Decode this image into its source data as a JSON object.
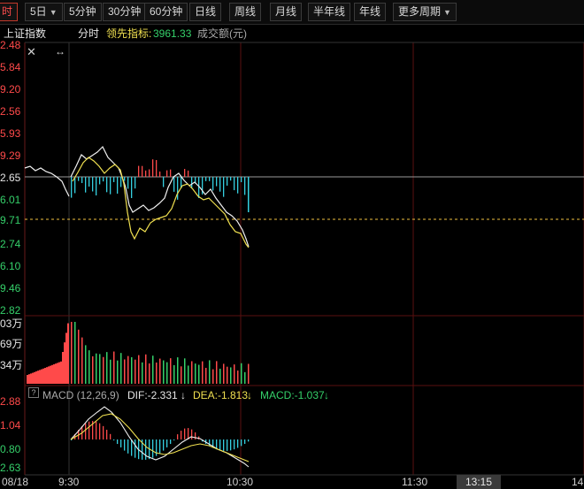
{
  "toolbar": {
    "items": [
      {
        "label": "时",
        "active": true
      },
      {
        "label": "5日",
        "dropdown": true
      },
      {
        "label": "5分钟"
      },
      {
        "label": "30分钟"
      },
      {
        "label": "60分钟"
      },
      {
        "label": "日线"
      },
      {
        "label": "周线"
      },
      {
        "label": "月线"
      },
      {
        "label": "半年线"
      },
      {
        "label": "年线"
      },
      {
        "label": "更多周期",
        "dropdown": true
      }
    ]
  },
  "infobar": {
    "name": "上证指数",
    "mode": "分时",
    "leading_label": "领先指标:",
    "leading_value": "3961.33",
    "volume_label": "成交额(元)"
  },
  "price_axis": [
    "2.48",
    "5.84",
    "9.20",
    "2.56",
    "5.93",
    "9.29",
    "2.65",
    "6.01",
    "9.71",
    "2.74",
    "6.10",
    "9.46",
    "2.82"
  ],
  "volume_axis": [
    "03万",
    "69万",
    "34万"
  ],
  "macd": {
    "help": "?",
    "title": "MACD (12,26,9)",
    "dif": "DIF:-2.331",
    "dea": "DEA:-1.813",
    "macd": "MACD:-1.037",
    "arrow": "↓",
    "axis": [
      "2.88",
      "1.04",
      "0.80",
      "2.63"
    ]
  },
  "xaxis": {
    "labels": [
      "08/18",
      "9:30",
      "10:30",
      "11:30",
      "13:15",
      "14"
    ]
  },
  "colors": {
    "up": "#ff4a4a",
    "down": "#35d0e0",
    "price": "#f0f0f0",
    "avg": "#f0e050",
    "grid": "#5a1010"
  },
  "icons": {
    "close": "close-icon",
    "resize": "resize-horizontal-icon"
  }
}
